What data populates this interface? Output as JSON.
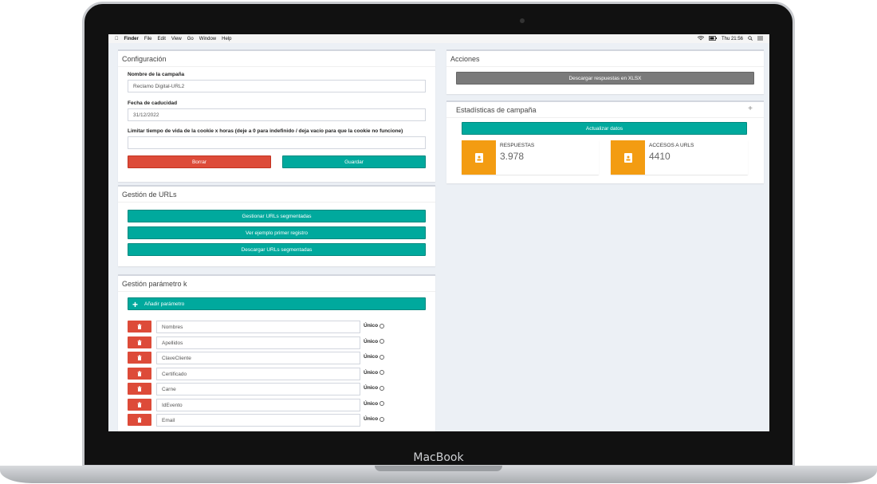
{
  "device": {
    "brand": "MacBook"
  },
  "menubar": {
    "apple_icon": "apple-icon",
    "items": [
      "Finder",
      "File",
      "Edit",
      "View",
      "Go",
      "Window",
      "Help"
    ],
    "clock": "Thu 21:56"
  },
  "config": {
    "title": "Configuración",
    "campaign_name_label": "Nombre de la campaña",
    "campaign_name_value": "Reclamo Digital-URL2",
    "expiry_label": "Fecha de caducidad",
    "expiry_value": "31/12/2022",
    "cookie_label": "Limitar tiempo de vida de la cookie x horas (deje a 0 para indefinido / deja vacío para que la cookie no funcione)",
    "cookie_value": "",
    "delete_label": "Borrar",
    "save_label": "Guardar"
  },
  "urls": {
    "title": "Gestión de URLs",
    "manage_label": "Gestionar URLs segmentadas",
    "example_label": "Ver ejemplo primer registro",
    "download_label": "Descargar URLs segmentadas"
  },
  "params": {
    "title": "Gestión parámetro k",
    "add_label": "Añadir parámetro",
    "unique_label": "Único",
    "items": [
      "Nombres",
      "Apellidos",
      "ClaveCliente",
      "Certificado",
      "Carne",
      "IdEvento",
      "Email"
    ]
  },
  "actions": {
    "title": "Acciones",
    "download_xlsx_label": "Descargar respuestas en XLSX"
  },
  "stats": {
    "title": "Estadísticas de campaña",
    "refresh_label": "Actualizar datos",
    "responses_label": "RESPUESTAS",
    "responses_value": "3.978",
    "accesses_label": "ACCESOS A URLS",
    "accesses_value": "4410"
  },
  "colors": {
    "teal": "#00a99d",
    "red": "#dd4b39",
    "orange": "#f39c12",
    "gray": "#7a7a7a"
  }
}
